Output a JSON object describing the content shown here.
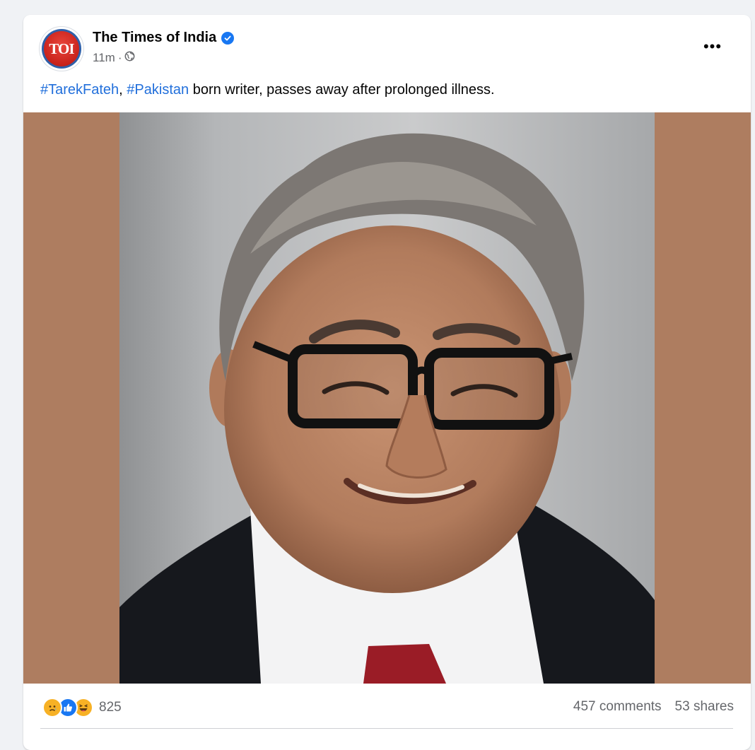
{
  "post": {
    "page_name": "The Times of India",
    "avatar_text": "TOI",
    "verified_icon": "verified-badge-icon",
    "time": "11m",
    "separator": "·",
    "privacy_icon": "globe-icon",
    "more_label": "•••",
    "text": {
      "hashtag_1": "#TarekFateh",
      "comma": ",",
      "hashtag_2": "#Pakistan",
      "body": "born writer, passes away after prolonged illness."
    },
    "image": {
      "subject": "photo-of-tarek-fateh",
      "side_color": "#ae7d60"
    },
    "reactions": {
      "icons": [
        "sad-reaction-icon",
        "like-reaction-icon",
        "haha-reaction-icon"
      ],
      "count": "825"
    },
    "comments": "457 comments",
    "shares": "53 shares"
  },
  "colors": {
    "background": "#f0f2f5",
    "card": "#ffffff",
    "link": "#216fdb",
    "secondary_text": "#65676b",
    "verified": "#1877f2"
  }
}
